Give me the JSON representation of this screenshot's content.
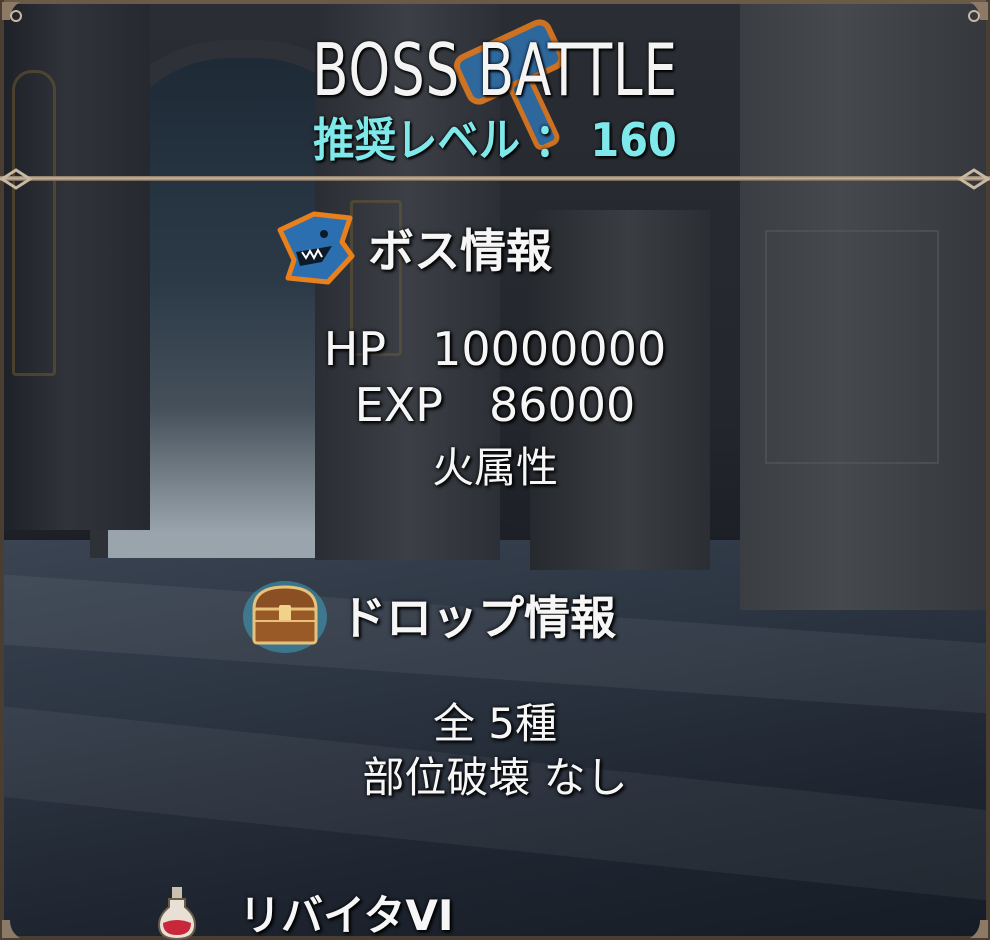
{
  "header": {
    "title": "BOSS BATTLE",
    "recommended_level": "推奨レベル ： 160"
  },
  "boss_info": {
    "heading": "ボス情報",
    "icon": "shark-helmet-icon",
    "hp_label": "HP",
    "hp_value": "10000000",
    "exp_label": "EXP",
    "exp_value": "86000",
    "element": "火属性"
  },
  "drop_info": {
    "heading": "ドロップ情報",
    "icon": "treasure-chest-icon",
    "total": "全 5種",
    "part_break": "部位破壊 なし",
    "items": [
      {
        "icon": "potion-icon",
        "name": "リバイタVI"
      }
    ]
  },
  "colors": {
    "title": "#f4f4f4",
    "level_accent": "#7fe8ea",
    "frame": "#c9b8a2"
  }
}
